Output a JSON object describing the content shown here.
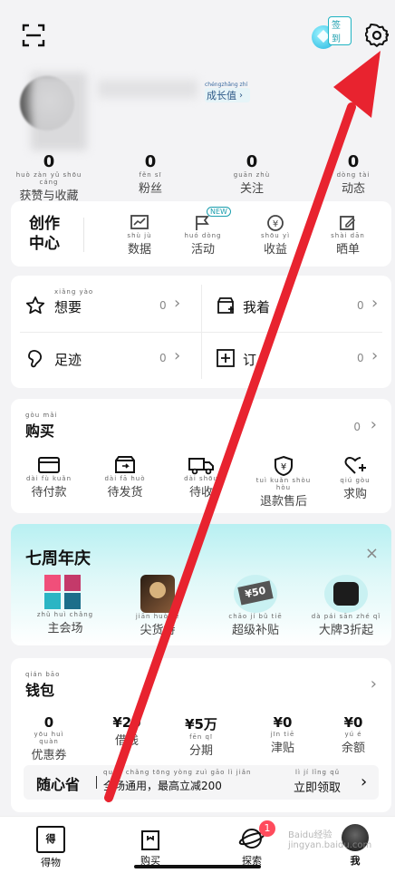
{
  "header": {
    "signin_badge": "签到"
  },
  "profile": {
    "growth_pinyin": "chéngzhǎng zhí",
    "growth_label": "成长值"
  },
  "stats": [
    {
      "value": "0",
      "pinyin": "huò zàn yǔ shōu cáng",
      "label": "获赞与收藏"
    },
    {
      "value": "0",
      "pinyin": "fěn sī",
      "label": "粉丝"
    },
    {
      "value": "0",
      "pinyin": "guān zhù",
      "label": "关注"
    },
    {
      "value": "0",
      "pinyin": "dòng tài",
      "label": "动态"
    }
  ],
  "creator": {
    "title_line1": "创作",
    "title_line2": "中心",
    "new_badge": "NEW",
    "items": [
      {
        "pinyin": "shù jù",
        "label": "数据"
      },
      {
        "pinyin": "huó dòng",
        "label": "活动"
      },
      {
        "pinyin": "shōu yì",
        "label": "收益"
      },
      {
        "pinyin": "shài dān",
        "label": "晒单"
      }
    ]
  },
  "quick": [
    {
      "pinyin": "xiǎng yào",
      "label": "想要",
      "count": "0"
    },
    {
      "pinyin": "",
      "label": "我着",
      "count": "0"
    },
    {
      "pinyin": "",
      "label": "足迹",
      "count": "0"
    },
    {
      "pinyin": "",
      "label": "订",
      "count": "0"
    }
  ],
  "buy": {
    "pinyin": "gòu mǎi",
    "title": "购买",
    "count": "0",
    "items": [
      {
        "pinyin": "dài fù kuǎn",
        "label": "待付款"
      },
      {
        "pinyin": "dài fā huò",
        "label": "待发货"
      },
      {
        "pinyin": "dài shōu",
        "label": "待收"
      },
      {
        "pinyin": "tuì kuǎn shòu hòu",
        "label": "退款售后"
      },
      {
        "pinyin": "qiú gòu",
        "label": "求购"
      }
    ]
  },
  "anniversary": {
    "title": "七周年庆",
    "items": [
      {
        "pinyin": "zhǔ huì chǎng",
        "label": "主会场"
      },
      {
        "pinyin": "jiān huò tè",
        "label": "尖货持"
      },
      {
        "pinyin": "chāo jí bǔ tiē",
        "label": "超级补贴"
      },
      {
        "pinyin": "dà pái sān zhé qǐ",
        "label": "大牌3折起"
      }
    ],
    "subsidy_text": "¥50"
  },
  "wallet": {
    "pinyin": "qián bāo",
    "title": "钱包",
    "items": [
      {
        "value": "0",
        "pinyin": "yōu huì quàn",
        "label": "优惠券"
      },
      {
        "value": "¥20",
        "pinyin": "",
        "label": "借钱"
      },
      {
        "value": "¥5万",
        "pinyin": "fēn qī",
        "label": "分期"
      },
      {
        "value": "¥0",
        "pinyin": "jīn tiē",
        "label": "津贴"
      },
      {
        "value": "¥0",
        "pinyin": "yú é",
        "label": "余额"
      }
    ],
    "promo_brand": "随心省",
    "promo_text": "全场通用，最高立减200",
    "promo_pinyin": "quán chǎng tōng yòng zuì gāo lì jiǎn",
    "promo_cta": "立即领取",
    "promo_cta_pinyin": "lì jí lǐng qǔ"
  },
  "tabbar": [
    {
      "label": "得物"
    },
    {
      "label": "购买"
    },
    {
      "label": "探索",
      "badge": "1"
    },
    {
      "label": "我"
    }
  ],
  "watermark": "Baidu经验\njingyan.baidu.com"
}
